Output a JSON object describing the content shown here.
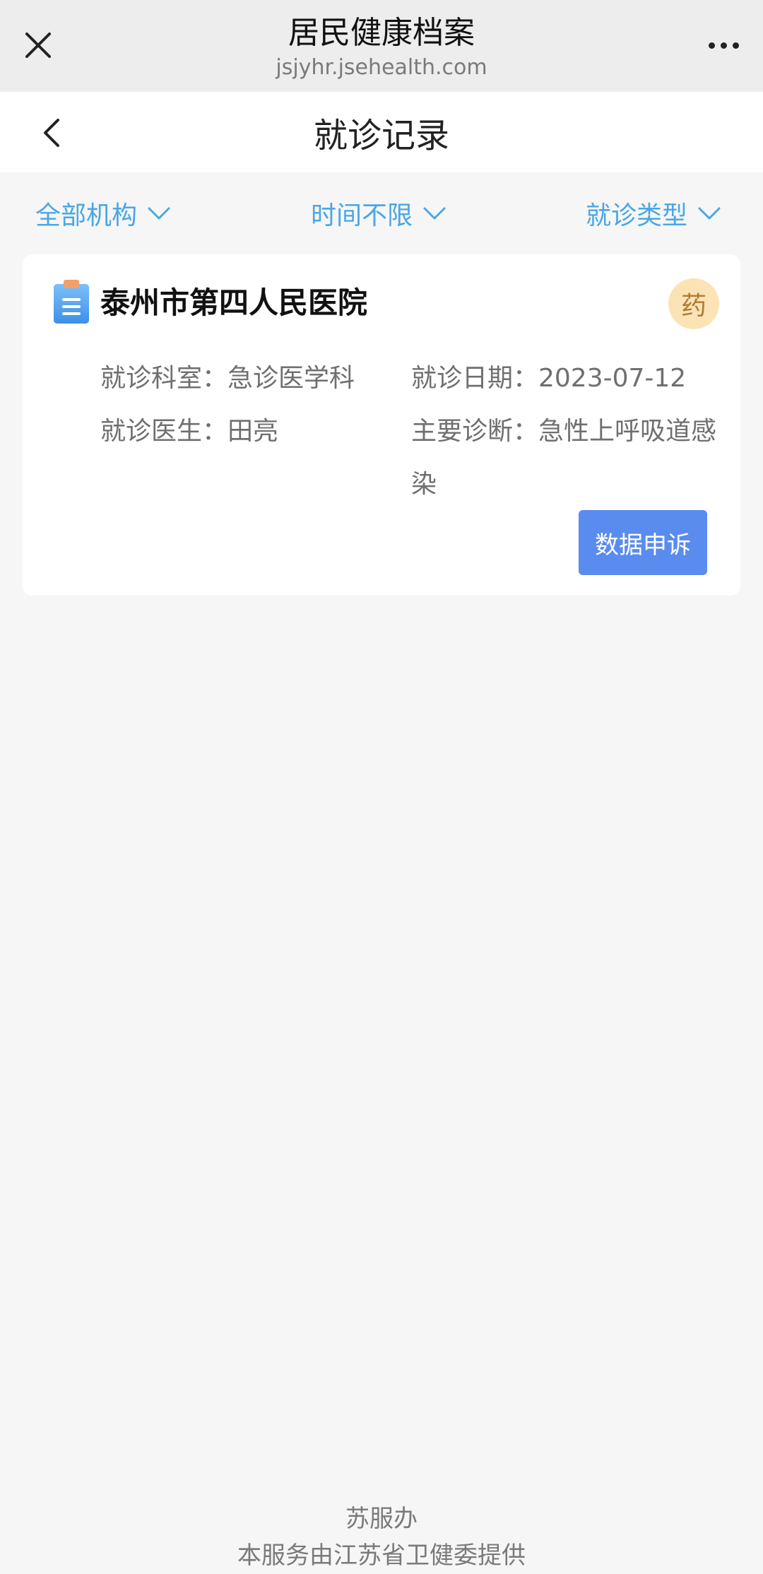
{
  "topbar": {
    "title": "居民健康档案",
    "subtitle": "jsjyhr.jsehealth.com"
  },
  "header": {
    "page_title": "就诊记录"
  },
  "filters": [
    {
      "label": "全部机构"
    },
    {
      "label": "时间不限"
    },
    {
      "label": "就诊类型"
    }
  ],
  "record": {
    "hospital": "泰州市第四人民医院",
    "badge": "药",
    "department": "就诊科室：急诊医学科",
    "date": "就诊日期：2023-07-12",
    "doctor": "就诊医生：田亮",
    "diagnosis": "主要诊断：急性上呼吸道感染",
    "appeal_label": "数据申诉"
  },
  "footer": {
    "line1": "苏服办",
    "line2": "本服务由江苏省卫健委提供"
  },
  "colors": {
    "accent_blue": "#4aa6e6",
    "button_blue": "#5a8cef",
    "badge_bg": "#fbe3b5",
    "badge_text": "#b07a32"
  }
}
